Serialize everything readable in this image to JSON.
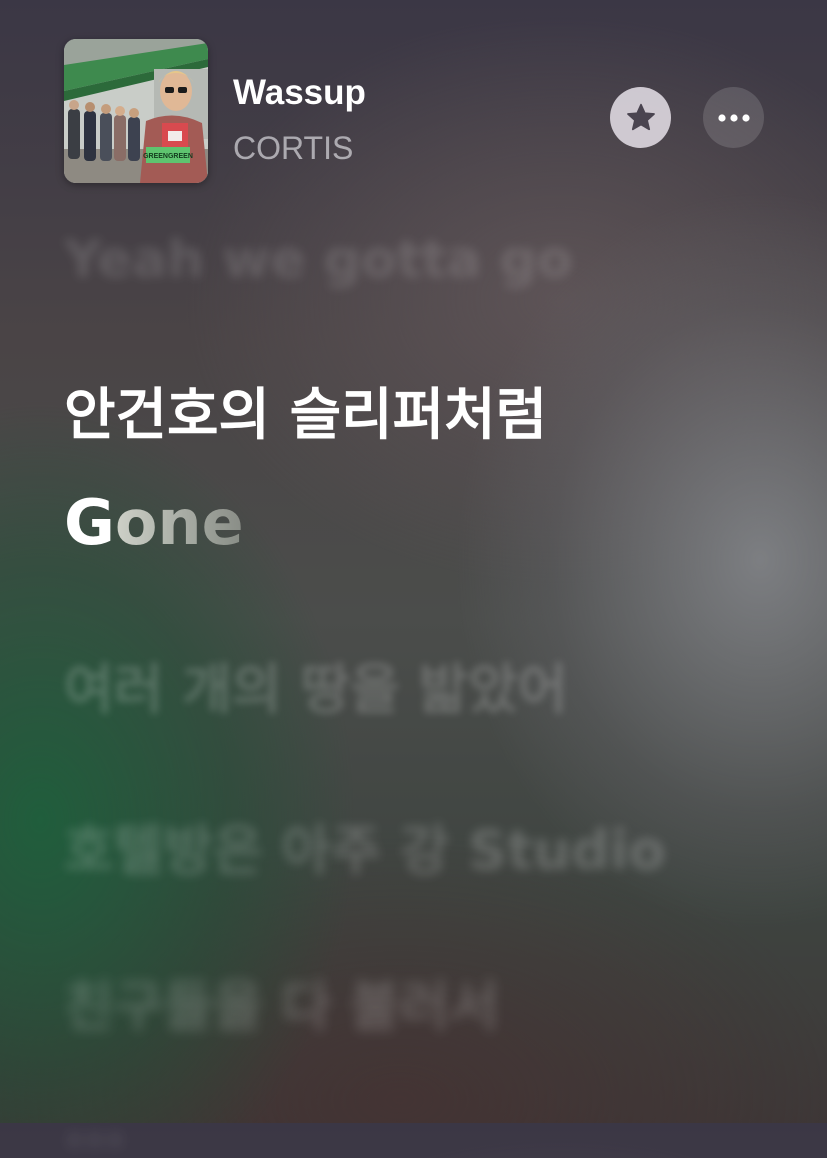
{
  "track": {
    "title": "Wassup",
    "artist": "CORTIS",
    "album_art_text": "GREENGREEN"
  },
  "buttons": {
    "favorite_icon": "star-icon",
    "more_icon": "ellipsis-icon"
  },
  "lyrics": {
    "previous": "Yeah we gotta go",
    "active": "안건호의 슬리퍼처럼",
    "current_sung": "G",
    "current_unsung": "one",
    "next_1": "여러 개의 땅을 밟았어",
    "next_2": "호텔방은 아주 강 Studio",
    "next_3": "친구들을 다 불러서",
    "next_4": "..."
  },
  "colors": {
    "title": "#ffffff",
    "artist": "#b7b6bb",
    "favorite_button_bg": "#e1dce4",
    "favorite_icon": "#4a4450",
    "more_button_bg": "#5c5860"
  }
}
